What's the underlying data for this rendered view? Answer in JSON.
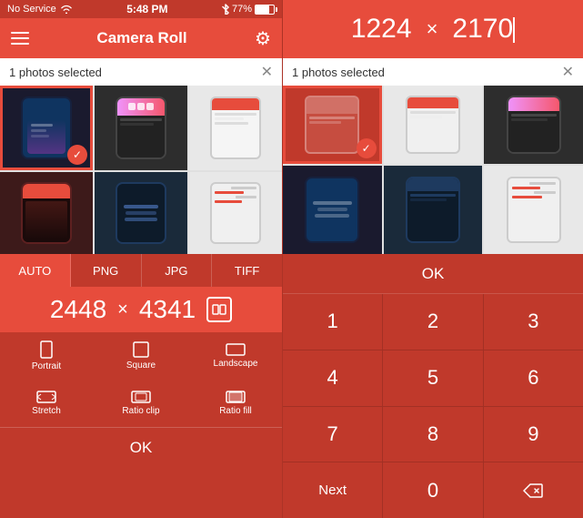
{
  "status_bar_left": {
    "service": "No Service",
    "wifi_icon": "wifi-icon"
  },
  "status_bar_center": {
    "time": "5:48 PM"
  },
  "status_bar_right": {
    "bluetooth": "bluetooth-icon",
    "battery_percent": "77%"
  },
  "left": {
    "title": "Camera Roll",
    "selection_text": "1 photos selected",
    "format_tabs": [
      "AUTO",
      "PNG",
      "JPG",
      "TIFF"
    ],
    "active_tab": "AUTO",
    "width": "2448",
    "height": "4341",
    "modes": [
      {
        "label": "Portrait",
        "icon": "portrait-icon"
      },
      {
        "label": "Square",
        "icon": "square-icon"
      },
      {
        "label": "Landscape",
        "icon": "landscape-icon"
      },
      {
        "label": "Stretch",
        "icon": "stretch-icon"
      },
      {
        "label": "Ratio clip",
        "icon": "ratio-clip-icon"
      },
      {
        "label": "Ratio fill",
        "icon": "ratio-fill-icon"
      }
    ],
    "ok_label": "OK"
  },
  "right": {
    "dim_width": "1224",
    "dim_x": "×",
    "dim_height": "2170",
    "selection_text": "1 photos selected",
    "ok_label": "OK",
    "numpad_keys": [
      "1",
      "2",
      "3",
      "4",
      "5",
      "6",
      "7",
      "8",
      "9",
      "Next",
      "0",
      "⌫"
    ]
  }
}
